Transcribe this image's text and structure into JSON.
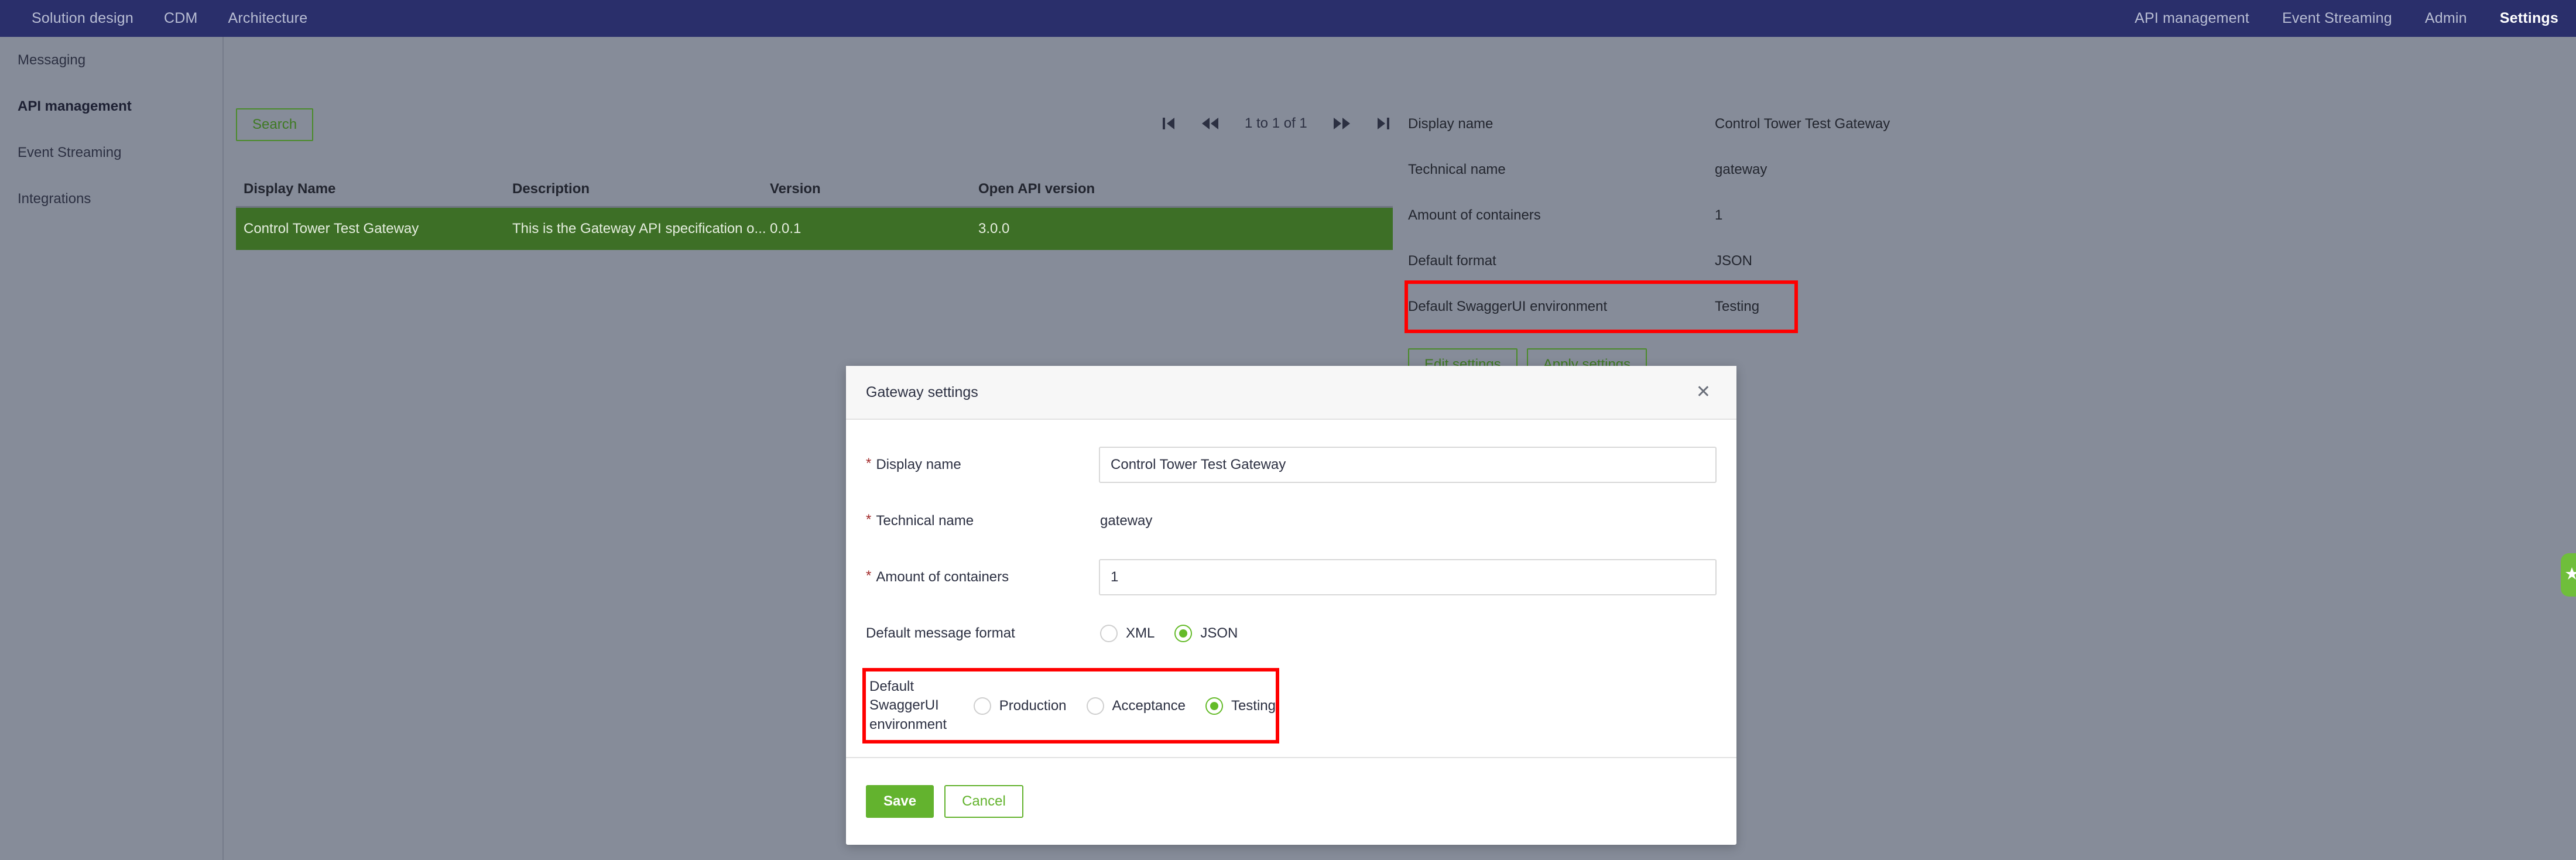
{
  "topnav": {
    "left_items": [
      {
        "label": "Solution design",
        "active": false
      },
      {
        "label": "CDM",
        "active": false
      },
      {
        "label": "Architecture",
        "active": false
      }
    ],
    "right_items": [
      {
        "label": "API management",
        "active": false
      },
      {
        "label": "Event Streaming",
        "active": false
      },
      {
        "label": "Admin",
        "active": false
      },
      {
        "label": "Settings",
        "active": true
      }
    ]
  },
  "sidebar": {
    "items": [
      {
        "label": "Messaging",
        "active": false
      },
      {
        "label": "API management",
        "active": true
      },
      {
        "label": "Event Streaming",
        "active": false
      },
      {
        "label": "Integrations",
        "active": false
      }
    ]
  },
  "toolbar": {
    "search_label": "Search"
  },
  "pagination": {
    "first_icon": "first-page-icon",
    "prev_icon": "prev-page-icon",
    "label": "1 to 1 of 1",
    "next_icon": "next-page-icon",
    "last_icon": "last-page-icon"
  },
  "table": {
    "columns": [
      "Display Name",
      "Description",
      "Version",
      "Open API version"
    ],
    "rows": [
      {
        "display_name": "Control Tower Test Gateway",
        "description": "This is the Gateway API specification o...",
        "version": "0.0.1",
        "open_api_version": "3.0.0",
        "selected": true
      }
    ]
  },
  "detail": {
    "fields": [
      {
        "label": "Display name",
        "value": "Control Tower Test Gateway",
        "highlight": false
      },
      {
        "label": "Technical name",
        "value": "gateway",
        "highlight": false
      },
      {
        "label": "Amount of containers",
        "value": "1",
        "highlight": false
      },
      {
        "label": "Default format",
        "value": "JSON",
        "highlight": false
      },
      {
        "label": "Default SwaggerUI environment",
        "value": "Testing",
        "highlight": true
      }
    ],
    "edit_label": "Edit settings",
    "apply_label": "Apply settings"
  },
  "modal": {
    "title": "Gateway settings",
    "close_icon": "close-icon",
    "display_name": {
      "label": "Display name",
      "required_marker": "*",
      "value": "Control Tower Test Gateway",
      "placeholder": ""
    },
    "technical_name": {
      "label": "Technical name",
      "required_marker": "*",
      "value": "gateway"
    },
    "amount_of_containers": {
      "label": "Amount of containers",
      "required_marker": "*",
      "value": "1",
      "placeholder": ""
    },
    "message_format": {
      "label": "Default message format",
      "options": [
        {
          "label": "XML",
          "selected": false
        },
        {
          "label": "JSON",
          "selected": true
        }
      ]
    },
    "swagger_environment": {
      "label": "Default SwaggerUI environment",
      "options": [
        {
          "label": "Production",
          "selected": false
        },
        {
          "label": "Acceptance",
          "selected": false
        },
        {
          "label": "Testing",
          "selected": true
        }
      ]
    },
    "save_label": "Save",
    "cancel_label": "Cancel"
  },
  "feedback_tab": {
    "icon": "feedback-icon"
  },
  "colors": {
    "nav_bg": "#2a2f6b",
    "page_bg": "#868c99",
    "accent_green": "#63b32e",
    "row_green": "#3d6f26",
    "highlight_red": "#ff0000"
  }
}
